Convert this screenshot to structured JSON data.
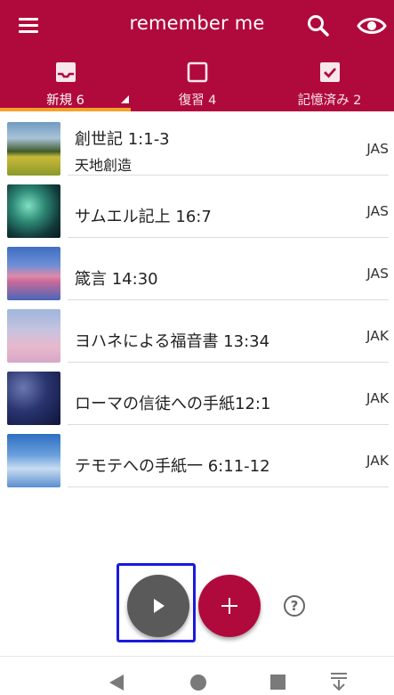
{
  "app": {
    "title": "remember me",
    "accent_color": "#b00a3c",
    "tab_indicator_color": "#f7a12b"
  },
  "tabs": [
    {
      "label": "新規 6",
      "icon": "inbox-icon",
      "active": true
    },
    {
      "label": "復習 4",
      "icon": "checkbox-blank-icon",
      "active": false
    },
    {
      "label": "記憶済み 2",
      "icon": "checkbox-checked-icon",
      "active": false
    }
  ],
  "verses": [
    {
      "title": "創世記 1:1-3",
      "subtitle": "天地創造",
      "tag": "JAS",
      "thumb": "field-landscape-image"
    },
    {
      "title": "サムエル記上 16:7",
      "subtitle": "",
      "tag": "JAS",
      "thumb": "aurora-image"
    },
    {
      "title": "箴言 14:30",
      "subtitle": "",
      "tag": "JAS",
      "thumb": "sunset-sea-image"
    },
    {
      "title": "ヨハネによる福音書 13:34",
      "subtitle": "",
      "tag": "JAK",
      "thumb": "pink-clouds-image"
    },
    {
      "title": "ローマの信徒への手紙12:1",
      "subtitle": "",
      "tag": "JAK",
      "thumb": "starry-sky-image"
    },
    {
      "title": "テモテへの手紙一 6:11-12",
      "subtitle": "",
      "tag": "JAK",
      "thumb": "blue-sky-clouds-image"
    }
  ],
  "actions": {
    "play_icon": "play-icon",
    "add_symbol": "+",
    "help_symbol": "?"
  }
}
